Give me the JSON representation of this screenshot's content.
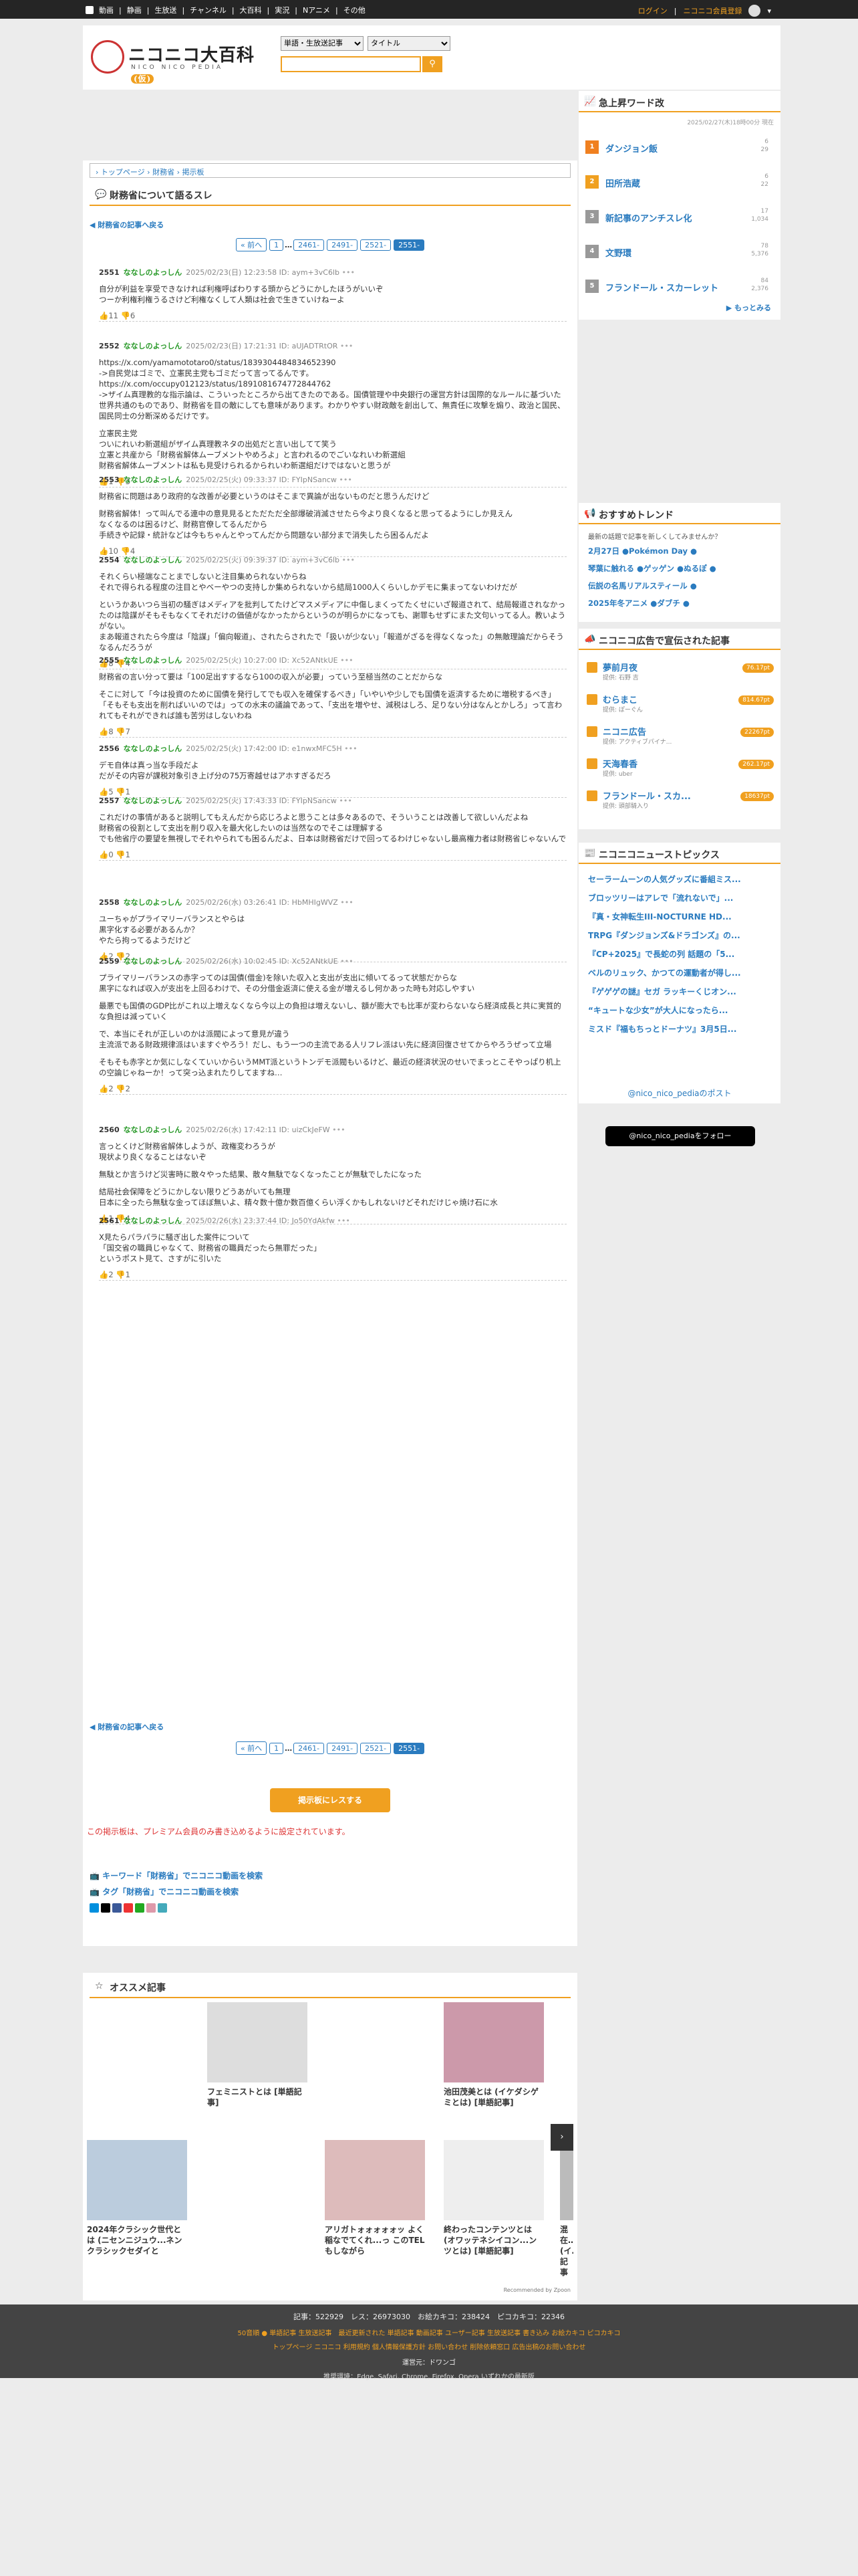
{
  "topbar": {
    "items": [
      "動画",
      "静画",
      "生放送",
      "チャンネル",
      "大百科",
      "実況",
      "Nアニメ",
      "その他"
    ],
    "login": "ログイン",
    "register": "ニコニコ会員登録"
  },
  "logo": {
    "title": "ニコニコ大百科",
    "tag": "(仮)",
    "sub": "NICO NICO PEDIA"
  },
  "search": {
    "type": "単語・生放送記事",
    "field": "タイトル"
  },
  "breadcrumb": [
    "トップページ",
    "財務省",
    "掲示板"
  ],
  "forum_title": "財務省について語るスレ",
  "back": "財務省の記事へ戻る",
  "pager": [
    "« 前へ",
    "1",
    "…",
    "2461-",
    "2491-",
    "2521-",
    "2551-"
  ],
  "posts": [
    {
      "no": "2551",
      "name": "ななしのよっしん",
      "date": "2025/02/23(日) 12:23:58 ID: aym+3vC6lb",
      "body": [
        "自分が利益を享受できなければ利権呼ばわりする頭からどうにかしたほうがいいぞ",
        "つーか利権利権うるさけど利権なくして人類は社会で生きていけねーよ"
      ],
      "foot": "👍11 👎6"
    },
    {
      "no": "2552",
      "name": "ななしのよっしん",
      "date": "2025/02/23(日) 17:21:31 ID: aUJADTRtOR",
      "body": [
        "https://x.com/yamamototaro0/status/1839304484834652390",
        "->自民党はゴミで、立憲民主党もゴミだって言ってるんです。",
        "https://x.com/occupy012123/status/1891081674772844762",
        "->ザイム真理教的な指示論は、こういったところから出てきたのである。国債管理や中央銀行の運営方針は国際的なルールに基づいた世界共通のものであり、財務省を目の敵にしても意味があります。わかりやすい財政敵を創出して、無責任に攻撃を煽り、政治と国民、国民同士の分断深めるだけです。",
        "",
        "立憲民主党",
        "ついにれいわ新選組がザイム真理教ネタの出処だと言い出してて笑う",
        "立憲と共産から「財務省解体ムーブメントやめろよ」と言われるのでごいなれいわ新選組",
        "財務省解体ムーブメントは私も見受けられるかられいわ新選組だけではないと思うが"
      ],
      "foot": "👍1 👎3"
    },
    {
      "no": "2553",
      "name": "ななしのよっしん",
      "date": "2025/02/25(火) 09:33:37 ID: FYIpNSancw",
      "body": [
        "財務省に問題はあり政府的な改善が必要というのはそこまで異論が出ないものだと思うんだけど",
        "",
        "財務省解体！って叫んでる連中の意見見るとただただ全部爆破消滅させたら今より良くなると思ってるようにしか見えん",
        "なくなるのは困るけど、財務官僚してるんだから",
        "手続きや記録・統計などは今もちゃんとやってんだから問題ない部分まで消失したら困るんだよ"
      ],
      "foot": "👍10 👎4"
    },
    {
      "no": "2554",
      "name": "ななしのよっしん",
      "date": "2025/02/25(火) 09:39:37 ID: aym+3vC6lb",
      "body": [
        "それくらい極端なことまでしないと注目集められないからね",
        "それで得られる程度の注目とやベーやつの支持しか集められないから結局1000人くらいしかデモに集まってないわけだが",
        "",
        "というかあいつら当初の騒ぎはメディアを批判してたけどマスメディアに中傷しまくってたくせにいざ報道されて、結局報道されなかったのは陰謀がそもそもなくてそれだけの価値がなかったからというのが明らかになっても、謝罪もせずにまた文句いってる人。教いようがない。",
        "まあ報道されたら今度は「陰謀」「偏向報道」、されたらされたで「扱いが少ない」「報道がざるを得なくなった」の無敵理論だからそうなるんだろうが"
      ],
      "foot": "👍8 👎4"
    },
    {
      "no": "2555",
      "name": "ななしのよっしん",
      "date": "2025/02/25(火) 10:27:00 ID: Xc52ANtkUE",
      "body": [
        "財務省の言い分って要は「100足出すするなら100の収入が必要」っていう至極当然のことだからな",
        "",
        "そこに対して「今は投資のために国債を発行してでも収入を確保するべき」「いやいや少しでも国債を返済するために増税するべき」「そもそも支出を削ればいいのでは」っての水末の議論であって、「支出を増やせ、減税はしろ、足りない分はなんとかしろ」って言われてもそれができれば誰も苦労はしないわね"
      ],
      "foot": "👍8 👎7"
    },
    {
      "no": "2556",
      "name": "ななしのよっしん",
      "date": "2025/02/25(火) 17:42:00 ID: e1nwxMFC5H",
      "body": [
        "デモ自体は真っ当な手段だよ",
        "だがその内容が課税対象引き上げ分の75万寄越せはアホすぎるだろ"
      ],
      "foot": "👍5 👎1"
    },
    {
      "no": "2557",
      "name": "ななしのよっしん",
      "date": "2025/02/25(火) 17:43:33 ID: FYIpNSancw",
      "body": [
        "これだけの事情があると説明してもえんだから応じろよと思うことは多々あるので、そういうことは改善して欲しいんだよね",
        "財務省の役割として支出を削り収入を最大化したいのは当然なのでそこは理解する",
        "でも他省庁の要望を無視しでそれやられても困るんだよ、日本は財務省だけで回ってるわけじゃないし最高権力者は財務省じゃないんで"
      ],
      "foot": "👍0 👎1"
    },
    {
      "no": "2558",
      "name": "ななしのよっしん",
      "date": "2025/02/26(水) 03:26:41 ID: HbMHIgWVZ",
      "body": [
        "ユーちゃがプライマリーバランスとやらは",
        "黒字化する必要があるんか？",
        "やたら拘ってるようだけど"
      ],
      "foot": "👍2 👎2"
    },
    {
      "no": "2559",
      "name": "ななしのよっしん",
      "date": "2025/02/26(水) 10:02:45 ID: Xc52ANtkUE",
      "body": [
        "プライマリーバランスの赤字ってのは国債(借金)を除いた収入と支出が支出に傾いてるって状態だからな",
        "黒字になれば収入が支出を上回るわけで、その分借金返済に使える金が増えるし何かあった時も対応しやすい",
        "",
        "最悪でも国債のGDP比がこれ以上増えなくなら今以上の負担は増えないし、額が膨大でも比率が変わらないなら経済成長と共に実質的な負担は減っていく",
        "",
        "で、本当にそれが正しいのかは派閥によって意見が違う",
        "主流派である財政規律派はいますぐやろう！だし、もう一つの主流である人リフレ派はい先に経済回復させてからやろうぜって立場",
        "",
        "そもそも赤字とか気にしなくていいからいうMMT派というトンデモ派閥もいるけど、最近の経済状況のせいでまっとこそやっぱり机上の空論じゃねーか！って突っ込まれたりしてますね…"
      ],
      "foot": "👍2 👎2"
    },
    {
      "no": "2560",
      "name": "ななしのよっしん",
      "date": "2025/02/26(水) 17:42:11 ID: uizCkJeFW",
      "body": [
        "言っとくけど財務省解体しようが、政権変わろうが",
        "現状より良くなることはないぞ",
        "",
        "無駄とか言うけど災害時に散々やった結果、散々無駄でなくなったことが無駄でしたになった",
        "",
        "結局社会保障をどうにかしない限りどうあがいても無理",
        "日本に全ったら無駄な金ってほぼ無いよ、精々数十億か数百億くらい浮くかもしれないけどそれだけじゃ焼け石に水"
      ],
      "foot": "👍1 👎4"
    },
    {
      "no": "2561",
      "name": "ななしのよっしん",
      "date": "2025/02/26(水) 23:37:44 ID: Jo50YdAkfw",
      "body": [
        "X見たらパラパラに騒ぎ出した案件について",
        "「国交省の職員じゃなくて、財務省の職員だったら無罪だった」",
        "というポスト見て、さすがに引いた"
      ],
      "foot": "👍2 👎1"
    }
  ],
  "good_btn": "掲示板にレスする",
  "warning": "この掲示板は、プレミアム会員のみ書き込めるように設定されています。",
  "search_links": [
    "キーワード「財務省」でニコニコ動画を検索",
    "タグ「財務省」でニコニコ動画を検索"
  ],
  "side": {
    "rank_title": "急上昇ワード改",
    "rank_date": "2025/02/27(木)18時00分 現在",
    "rank": [
      {
        "n": "1",
        "name": "ダンジョン飯",
        "c": [
          "6",
          "29"
        ]
      },
      {
        "n": "2",
        "name": "田所浩蔵",
        "c": [
          "6",
          "22"
        ]
      },
      {
        "n": "3",
        "name": "新記事のアンチスレ化",
        "c": [
          "17",
          "1,034"
        ]
      },
      {
        "n": "4",
        "name": "文野環",
        "c": [
          "78",
          "5,376"
        ]
      },
      {
        "n": "5",
        "name": "フランドール・スカーレット",
        "c": [
          "84",
          "2,376"
        ]
      }
    ],
    "more": "▶ もっとみる",
    "trend_title": "おすすめトレンド",
    "trend_note": "最新の話題で記事を新しくしてみませんか？",
    "trends": [
      "2月27日 ●Pokémon Day ●",
      "琴葉に触れる ●ゲッゲン ●ぬるぽ ●",
      "伝説の名馬リアルスティール ●",
      "2025年冬アニメ ●ダブチ ●"
    ],
    "ads_title": "ニコニコ広告で宣伝された記事",
    "ads": [
      {
        "t": "夢前月夜",
        "s": "提供: 石野 吉",
        "b": "76.17pt"
      },
      {
        "t": "むらまこ",
        "s": "提供: ぽーぐん",
        "b": "814.67pt"
      },
      {
        "t": "ニコニ広告",
        "s": "提供: アクティブパイナ...",
        "b": "22267pt"
      },
      {
        "t": "天海春香",
        "s": "提供: uber",
        "b": "262.17pt"
      },
      {
        "t": "フランドール・スカ...",
        "s": "提供: 頭部騎入り",
        "b": "18637pt"
      }
    ],
    "news_title": "ニコニコニューストピックス",
    "news": [
      "セーラームーンの人気グッズに番組ミス...",
      "ブロッツリーはアレで「流れないで」...",
      "『真・女神転生III-NOCTURNE HD...",
      "TRPG『ダンジョンズ&ドラゴンズ』の...",
      "『CP+2025』で長蛇の列 話題の「5...",
      "ベルのリュック、かつての運動者が得し...",
      "『ゲゲゲの謎』セガ ラッキーくじオン...",
      "“キュートな少女”が大人になったら...",
      "ミスド『福もちっとドーナツ』3月5日..."
    ],
    "x_title": "@nico_nico_pediaのポスト",
    "x_btn": "@nico_nico_pediaをフォロー"
  },
  "rec_title": "オススメ記事",
  "recs": [
    {
      "t": "フェミニストとは [単語記事]"
    },
    {
      "t": "池田茂美とは (イケダシゲミとは) [単語記事]"
    },
    {
      "t": "2024年クラシック世代とは (ニセンニジュウ...ネンクラシックセダイと"
    },
    {
      "t": "アリガトォォォォォッ よく稲なでてくれ...っ このTELもしながら"
    },
    {
      "t": "終わったコンテンツとは (オワッテネシイコン...ンツとは) [単語記事]"
    },
    {
      "t": "混在…(イ…記事"
    }
  ],
  "rec_by": "Recommended by Zpoon",
  "footer": {
    "r1": "記事：522929　レス：26973030　お絵カキコ：238424　ピコカキコ：22346",
    "r2": "50音順 ● 単語記事 生放送記事　最近更新された 単語記事 動画記事 ユーザー記事 生放送記事 書き込み お絵カキコ ピコカキコ",
    "r3": "トップページ ニコニコ 利用規約 個人情報保護方針 お問い合わせ 削除依頼窓口 広告出稿のお問い合わせ",
    "r4": "運営元：ドワンゴ",
    "r5": "推奨環境：Edge, Safari, Chrome, Firefox, Opera いずれかの最新版"
  },
  "colors": {
    "accent": "#f0a020",
    "link": "#2a7bbf"
  }
}
